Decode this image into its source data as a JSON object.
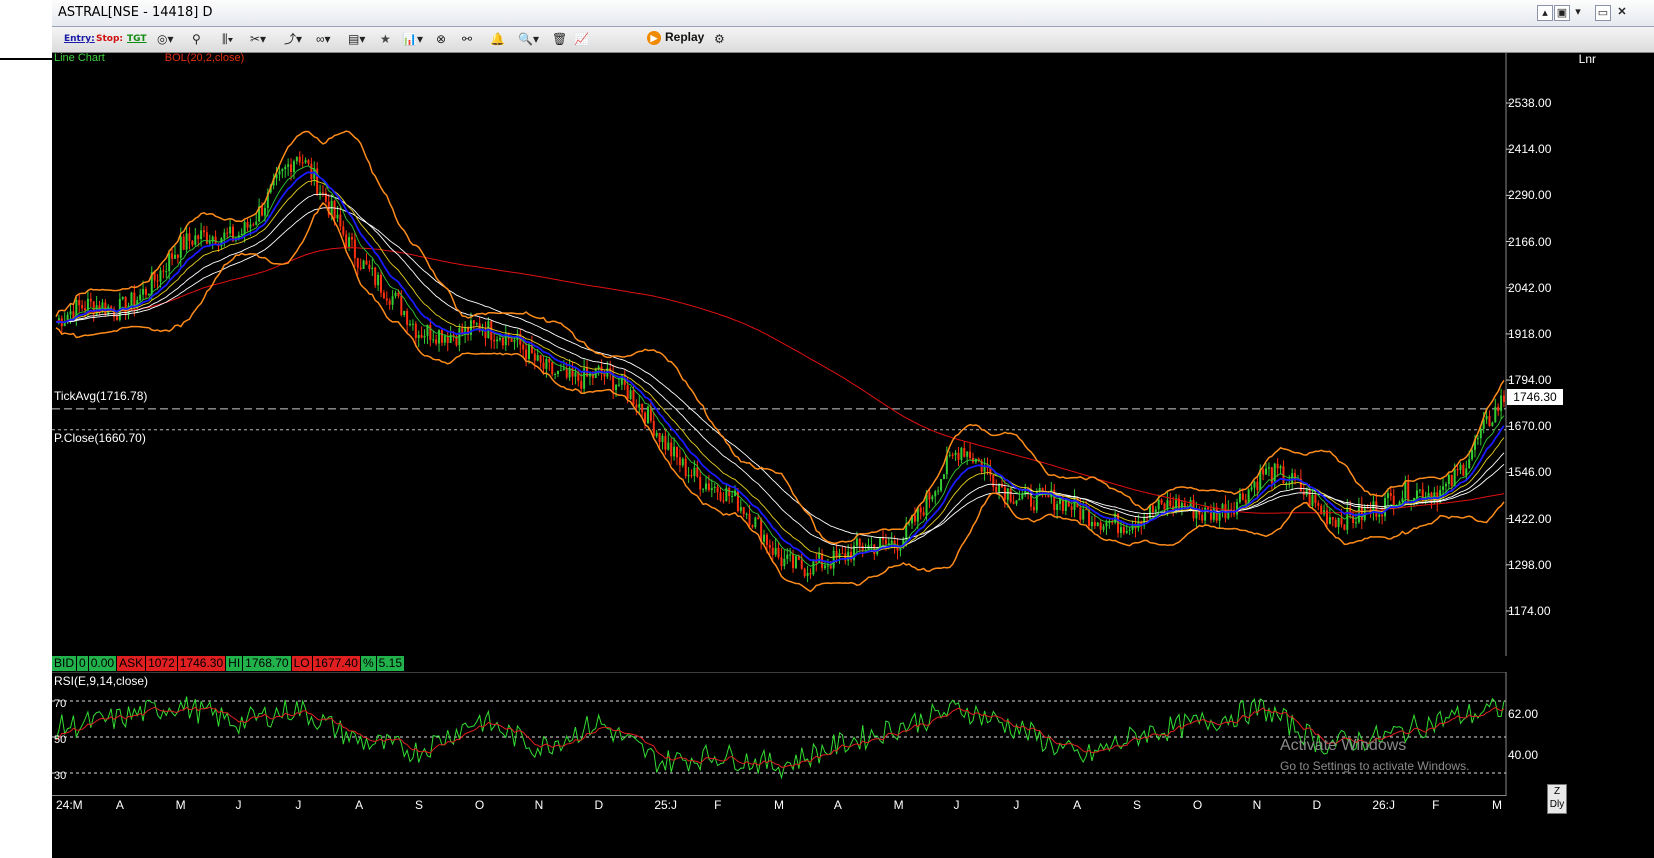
{
  "window": {
    "title": "ASTRAL[NSE - 14418] D",
    "buttons": [
      "▴",
      "▣",
      "▾",
      "▭",
      "✕"
    ]
  },
  "toolbar": {
    "entry_label": "Entry:",
    "stop_label": "Stop:",
    "tgt_label": "TGT",
    "replay_label": "Replay"
  },
  "chart": {
    "scale_mode": "Lnr",
    "tick_avg_label": "TickAvg(1716.78)",
    "prev_close_label": "P.Close(1660.70)",
    "last_price": "1746.30",
    "legend_visible": "Line Chart",
    "legend_indicator": "BOL(20,2,close)",
    "y_ticks": [
      "2538.00",
      "2414.00",
      "2290.00",
      "2166.00",
      "2042.00",
      "1918.00",
      "1794.00",
      "1670.00",
      "1546.00",
      "1422.00",
      "1298.00",
      "1174.00"
    ],
    "x_ticks": [
      "24:M",
      "A",
      "M",
      "J",
      "J",
      "A",
      "S",
      "O",
      "N",
      "D",
      "25:J",
      "F",
      "M",
      "A",
      "M",
      "J",
      "J",
      "A",
      "S",
      "O",
      "N",
      "D",
      "26:J",
      "F",
      "M"
    ],
    "colors": {
      "bollinger": "#ff8c1a",
      "ema_blue": "#1a1aff",
      "ema_white": "#ffffff",
      "sma_red": "#e01010",
      "ema_green": "#33cc33",
      "ema_yellow": "#e8d020",
      "up": "#33cc33",
      "down": "#ff3010"
    }
  },
  "chart_data": {
    "type": "line",
    "title": "",
    "ylim": [
      1100,
      2580
    ],
    "x": [
      "24:M",
      "A",
      "M",
      "J",
      "J",
      "A",
      "S",
      "O",
      "N",
      "D",
      "25:J",
      "F",
      "M",
      "A",
      "M",
      "J",
      "J",
      "A",
      "S",
      "O",
      "N",
      "D",
      "26:J",
      "F",
      "M"
    ],
    "series": [
      {
        "name": "",
        "values": [
          1950,
          1990,
          2130,
          2200,
          2380,
          2150,
          1900,
          1960,
          1820,
          1820,
          1650,
          1490,
          1330,
          1290,
          1390,
          1590,
          1500,
          1420,
          1440,
          1430,
          1540,
          1450,
          1440,
          1520,
          1720
        ]
      }
    ]
  },
  "quotes": {
    "bid_label": "BID",
    "bid_qty": "0",
    "bid_price": "0.00",
    "ask_label": "ASK",
    "ask_qty": "1072",
    "ask_price": "1746.30",
    "hi_label": "HI",
    "hi_value": "1768.70",
    "lo_label": "LO",
    "lo_value": "1677.40",
    "pct_label": "%",
    "pct_value": "5.15"
  },
  "rsi": {
    "label": "RSI(E,9,14,close)",
    "left_levels": [
      "70",
      "50",
      "30"
    ],
    "right_ticks": [
      "62.00",
      "40.00"
    ],
    "values": [
      55,
      60,
      68,
      58,
      66,
      48,
      42,
      60,
      44,
      58,
      36,
      40,
      34,
      46,
      56,
      66,
      54,
      38,
      52,
      58,
      66,
      46,
      50,
      60,
      66
    ]
  },
  "period": {
    "top": "Z",
    "bottom": "Dly"
  },
  "watermark": {
    "line1": "Activate Windows",
    "line2": "Go to Settings to activate Windows."
  }
}
